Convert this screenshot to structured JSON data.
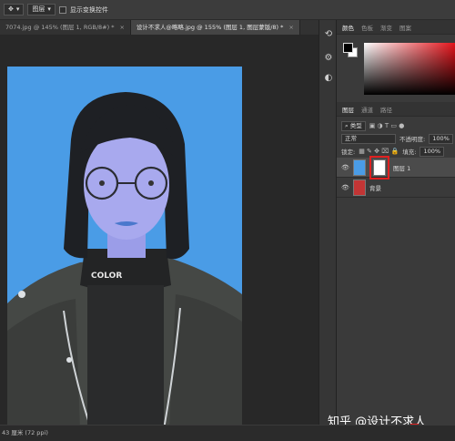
{
  "options_bar": {
    "mode_select": "图层",
    "show_transform_label": "显示变换控件"
  },
  "tabs": [
    {
      "label": "7074.jpg @ 145% (图层 1, RGB/8#) *",
      "active": false
    },
    {
      "label": "设计不求人@略略.jpg @ 155% (图层 1, 图层蒙版/8) *",
      "active": true
    }
  ],
  "photo": {
    "shirt_text": "COLOR"
  },
  "status_bar": {
    "text": "43 厘米 (72 ppi)"
  },
  "right_panel": {
    "top_tabs": [
      "颜色",
      "色板",
      "渐变",
      "图案"
    ],
    "layers_tabs": [
      "图层",
      "通道",
      "路径"
    ],
    "kind_label": "类型",
    "blend_mode": "正常",
    "opacity_label": "不透明度:",
    "opacity_value": "100%",
    "lock_label": "锁定:",
    "fill_label": "填充:",
    "fill_value": "100%",
    "layers": [
      {
        "name": "图层 1",
        "selected": true
      },
      {
        "name": "背景",
        "selected": false
      }
    ]
  },
  "watermark": "知乎 @设计不求人",
  "colors": {
    "photo_bg": "#4a9ce6",
    "highlight": "#e02020"
  }
}
